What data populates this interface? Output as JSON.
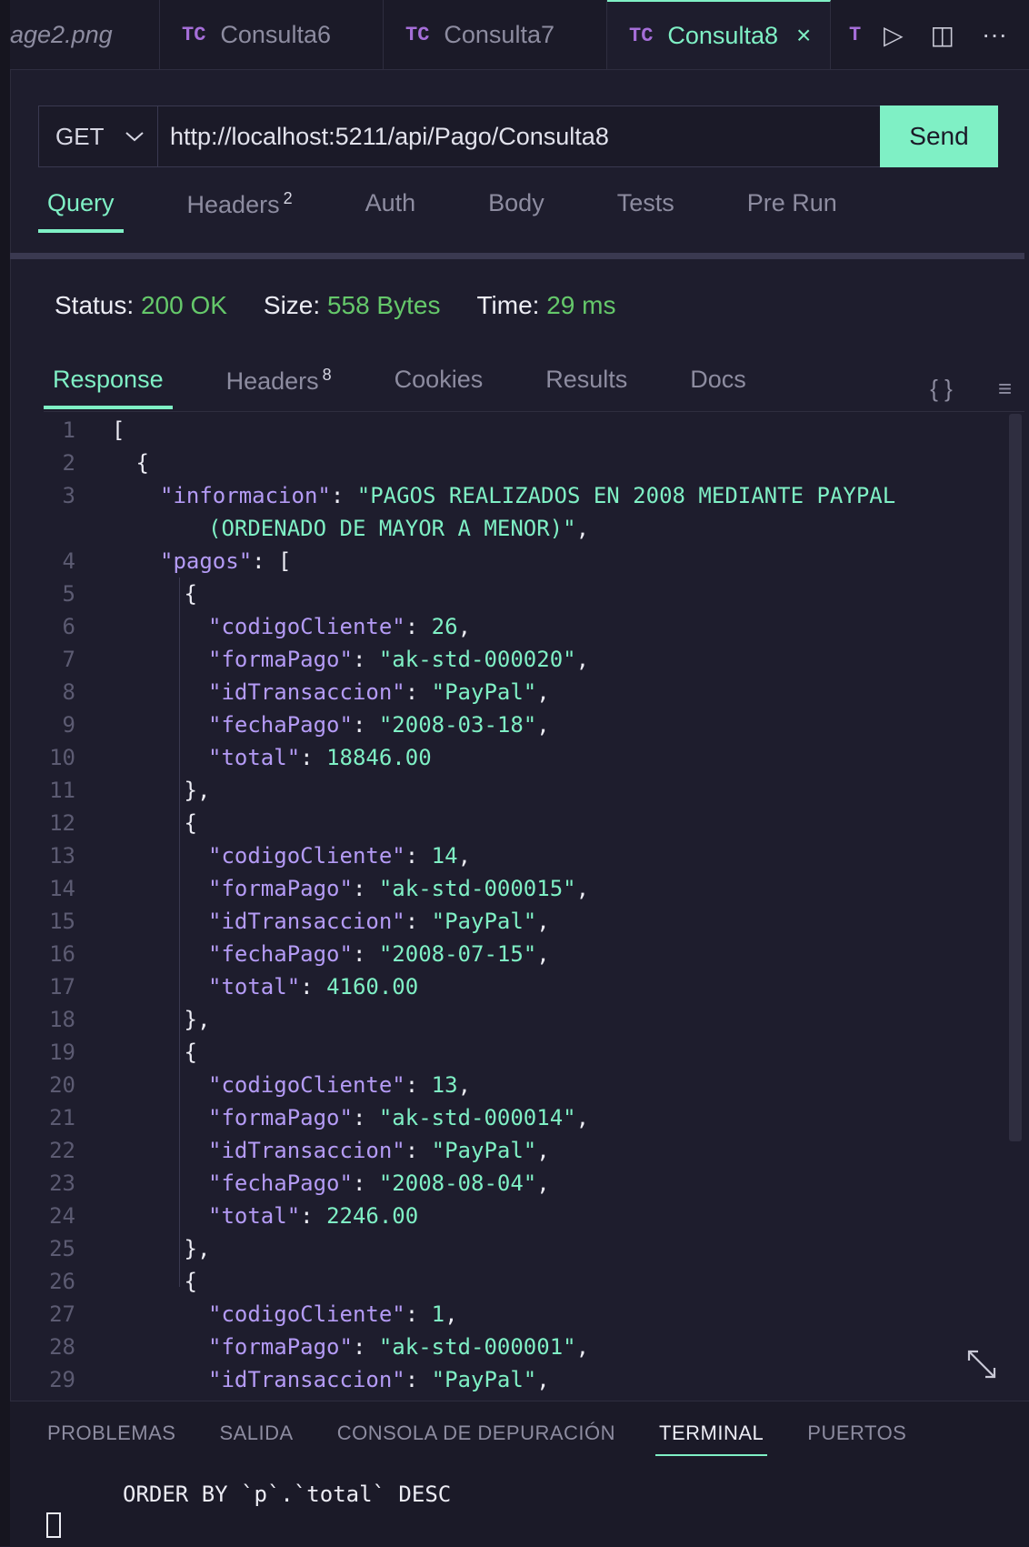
{
  "tabs": [
    {
      "label": "age2.png",
      "badge": "",
      "active": false
    },
    {
      "label": "Consulta6",
      "badge": "TC",
      "active": false
    },
    {
      "label": "Consulta7",
      "badge": "TC",
      "active": false
    },
    {
      "label": "Consulta8",
      "badge": "TC",
      "active": true
    },
    {
      "label": "",
      "badge": "T",
      "active": false
    }
  ],
  "tab_close": "×",
  "tab_actions": {
    "run": "▷",
    "split": "◫",
    "more": "···"
  },
  "request": {
    "method": "GET",
    "url": "http://localhost:5211/api/Pago/Consulta8",
    "send_label": "Send"
  },
  "request_tabs": [
    {
      "label": "Query",
      "count": ""
    },
    {
      "label": "Headers",
      "count": "2"
    },
    {
      "label": "Auth",
      "count": ""
    },
    {
      "label": "Body",
      "count": ""
    },
    {
      "label": "Tests",
      "count": ""
    },
    {
      "label": "Pre Run",
      "count": ""
    }
  ],
  "status": {
    "status_label": "Status:",
    "status_value": "200 OK",
    "size_label": "Size:",
    "size_value": "558 Bytes",
    "time_label": "Time:",
    "time_value": "29 ms"
  },
  "response_tabs": [
    {
      "label": "Response",
      "count": ""
    },
    {
      "label": "Headers",
      "count": "8"
    },
    {
      "label": "Cookies",
      "count": ""
    },
    {
      "label": "Results",
      "count": ""
    },
    {
      "label": "Docs",
      "count": ""
    }
  ],
  "response_icons": {
    "json": "{ }",
    "wrap": "≡"
  },
  "code_lines": [
    {
      "n": "1",
      "indent": 0,
      "parts": [
        [
          "p",
          "["
        ]
      ]
    },
    {
      "n": "2",
      "indent": 1,
      "parts": [
        [
          "p",
          "{"
        ]
      ]
    },
    {
      "n": "3",
      "indent": 2,
      "parts": [
        [
          "k",
          "\"informacion\""
        ],
        [
          "p",
          ": "
        ],
        [
          "s",
          "\"PAGOS REALIZADOS EN 2008 MEDIANTE PAYPAL"
        ]
      ]
    },
    {
      "n": "",
      "indent": 4,
      "parts": [
        [
          "s",
          "(ORDENADO DE MAYOR A MENOR)\""
        ],
        [
          "p",
          ","
        ]
      ]
    },
    {
      "n": "4",
      "indent": 2,
      "parts": [
        [
          "k",
          "\"pagos\""
        ],
        [
          "p",
          ": ["
        ]
      ]
    },
    {
      "n": "5",
      "indent": 3,
      "parts": [
        [
          "p",
          "{"
        ]
      ]
    },
    {
      "n": "6",
      "indent": 4,
      "parts": [
        [
          "k",
          "\"codigoCliente\""
        ],
        [
          "p",
          ": "
        ],
        [
          "n",
          "26"
        ],
        [
          "p",
          ","
        ]
      ]
    },
    {
      "n": "7",
      "indent": 4,
      "parts": [
        [
          "k",
          "\"formaPago\""
        ],
        [
          "p",
          ": "
        ],
        [
          "s",
          "\"ak-std-000020\""
        ],
        [
          "p",
          ","
        ]
      ]
    },
    {
      "n": "8",
      "indent": 4,
      "parts": [
        [
          "k",
          "\"idTransaccion\""
        ],
        [
          "p",
          ": "
        ],
        [
          "s",
          "\"PayPal\""
        ],
        [
          "p",
          ","
        ]
      ]
    },
    {
      "n": "9",
      "indent": 4,
      "parts": [
        [
          "k",
          "\"fechaPago\""
        ],
        [
          "p",
          ": "
        ],
        [
          "s",
          "\"2008-03-18\""
        ],
        [
          "p",
          ","
        ]
      ]
    },
    {
      "n": "10",
      "indent": 4,
      "parts": [
        [
          "k",
          "\"total\""
        ],
        [
          "p",
          ": "
        ],
        [
          "n",
          "18846.00"
        ]
      ]
    },
    {
      "n": "11",
      "indent": 3,
      "parts": [
        [
          "p",
          "},"
        ]
      ]
    },
    {
      "n": "12",
      "indent": 3,
      "parts": [
        [
          "p",
          "{"
        ]
      ]
    },
    {
      "n": "13",
      "indent": 4,
      "parts": [
        [
          "k",
          "\"codigoCliente\""
        ],
        [
          "p",
          ": "
        ],
        [
          "n",
          "14"
        ],
        [
          "p",
          ","
        ]
      ]
    },
    {
      "n": "14",
      "indent": 4,
      "parts": [
        [
          "k",
          "\"formaPago\""
        ],
        [
          "p",
          ": "
        ],
        [
          "s",
          "\"ak-std-000015\""
        ],
        [
          "p",
          ","
        ]
      ]
    },
    {
      "n": "15",
      "indent": 4,
      "parts": [
        [
          "k",
          "\"idTransaccion\""
        ],
        [
          "p",
          ": "
        ],
        [
          "s",
          "\"PayPal\""
        ],
        [
          "p",
          ","
        ]
      ]
    },
    {
      "n": "16",
      "indent": 4,
      "parts": [
        [
          "k",
          "\"fechaPago\""
        ],
        [
          "p",
          ": "
        ],
        [
          "s",
          "\"2008-07-15\""
        ],
        [
          "p",
          ","
        ]
      ]
    },
    {
      "n": "17",
      "indent": 4,
      "parts": [
        [
          "k",
          "\"total\""
        ],
        [
          "p",
          ": "
        ],
        [
          "n",
          "4160.00"
        ]
      ]
    },
    {
      "n": "18",
      "indent": 3,
      "parts": [
        [
          "p",
          "},"
        ]
      ]
    },
    {
      "n": "19",
      "indent": 3,
      "parts": [
        [
          "p",
          "{"
        ]
      ]
    },
    {
      "n": "20",
      "indent": 4,
      "parts": [
        [
          "k",
          "\"codigoCliente\""
        ],
        [
          "p",
          ": "
        ],
        [
          "n",
          "13"
        ],
        [
          "p",
          ","
        ]
      ]
    },
    {
      "n": "21",
      "indent": 4,
      "parts": [
        [
          "k",
          "\"formaPago\""
        ],
        [
          "p",
          ": "
        ],
        [
          "s",
          "\"ak-std-000014\""
        ],
        [
          "p",
          ","
        ]
      ]
    },
    {
      "n": "22",
      "indent": 4,
      "parts": [
        [
          "k",
          "\"idTransaccion\""
        ],
        [
          "p",
          ": "
        ],
        [
          "s",
          "\"PayPal\""
        ],
        [
          "p",
          ","
        ]
      ]
    },
    {
      "n": "23",
      "indent": 4,
      "parts": [
        [
          "k",
          "\"fechaPago\""
        ],
        [
          "p",
          ": "
        ],
        [
          "s",
          "\"2008-08-04\""
        ],
        [
          "p",
          ","
        ]
      ]
    },
    {
      "n": "24",
      "indent": 4,
      "parts": [
        [
          "k",
          "\"total\""
        ],
        [
          "p",
          ": "
        ],
        [
          "n",
          "2246.00"
        ]
      ]
    },
    {
      "n": "25",
      "indent": 3,
      "parts": [
        [
          "p",
          "},"
        ]
      ]
    },
    {
      "n": "26",
      "indent": 3,
      "parts": [
        [
          "p",
          "{"
        ]
      ]
    },
    {
      "n": "27",
      "indent": 4,
      "parts": [
        [
          "k",
          "\"codigoCliente\""
        ],
        [
          "p",
          ": "
        ],
        [
          "n",
          "1"
        ],
        [
          "p",
          ","
        ]
      ]
    },
    {
      "n": "28",
      "indent": 4,
      "parts": [
        [
          "k",
          "\"formaPago\""
        ],
        [
          "p",
          ": "
        ],
        [
          "s",
          "\"ak-std-000001\""
        ],
        [
          "p",
          ","
        ]
      ]
    },
    {
      "n": "29",
      "indent": 4,
      "parts": [
        [
          "k",
          "\"idTransaccion\""
        ],
        [
          "p",
          ": "
        ],
        [
          "s",
          "\"PayPal\""
        ],
        [
          "p",
          ","
        ]
      ]
    }
  ],
  "panel": {
    "tabs": [
      "PROBLEMAS",
      "SALIDA",
      "CONSOLA DE DEPURACIÓN",
      "TERMINAL",
      "PUERTOS"
    ],
    "active_tab": "TERMINAL",
    "terminal_line": "ORDER BY `p`.`total` DESC"
  },
  "colors": {
    "accent": "#7ff0c5",
    "key": "#b49bf5",
    "ok": "#65c86a",
    "background": "#1e1d2d"
  }
}
